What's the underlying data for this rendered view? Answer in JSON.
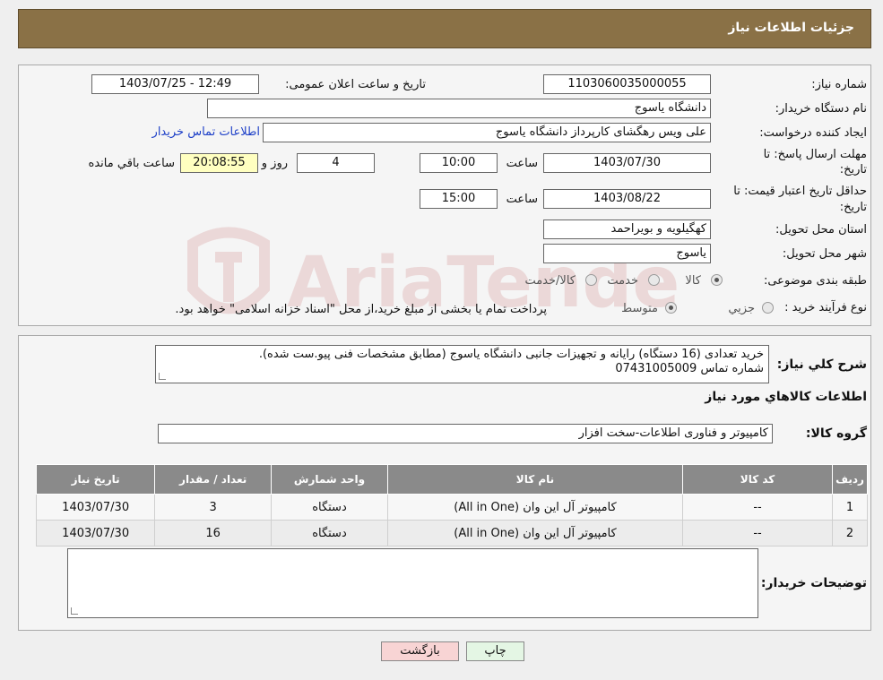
{
  "header": {
    "title": "جزئیات اطلاعات نیاز"
  },
  "form": {
    "need_number_label": "شماره نیاز:",
    "need_number": "1103060035000055",
    "announce_label": "تاریخ و ساعت اعلان عمومی:",
    "announce_value": "1403/07/25 - 12:49",
    "buyer_org_label": "نام دستگاه خریدار:",
    "buyer_org": "دانشگاه یاسوج",
    "requester_label": "ایجاد کننده درخواست:",
    "requester": "علی ویس رهگشای کارپرداز دانشگاه یاسوج",
    "contact_link": "اطلاعات تماس خریدار",
    "deadline_label_1": "مهلت ارسال پاسخ: تا",
    "deadline_label_2": "تاریخ:",
    "deadline_date": "1403/07/30",
    "time_label": "ساعت",
    "deadline_time": "10:00",
    "days_value": "4",
    "days_label": "روز و",
    "remaining_time": "20:08:55",
    "remaining_label": "ساعت باقي مانده",
    "validity_label_1": "حداقل تاریخ اعتبار قیمت: تا",
    "validity_label_2": "تاریخ:",
    "validity_date": "1403/08/22",
    "validity_time": "15:00",
    "province_label": "استان محل تحویل:",
    "province": "کهگیلویه و بویراحمد",
    "city_label": "شهر محل تحویل:",
    "city": "یاسوج",
    "category_label": "طبقه بندی موضوعی:",
    "category_options": [
      "کالا",
      "خدمت",
      "کالا/خدمت"
    ],
    "purchase_type_label": "نوع فرآیند خرید :",
    "purchase_options": [
      "جزیي",
      "متوسط"
    ],
    "purchase_note": "پرداخت تمام یا بخشی از مبلغ خرید،از محل \"اسناد خزانه اسلامی\" خواهد بود."
  },
  "details": {
    "description_label": "شرح کلي نياز:",
    "description_line1": "خرید تعدادی (16 دستگاه)  رایانه و تجهیزات جانبی دانشگاه یاسوج (مطابق مشخصات فنی پیو.ست شده).",
    "description_line2": "شماره تماس 07431005009",
    "goods_info_title": "اطلاعات کالاهاي مورد نياز",
    "goods_group_label": "گروه کالا:",
    "goods_group": "کامپیوتر و فناوری اطلاعات-سخت افزار",
    "table_headers": [
      "رديف",
      "کد کالا",
      "نام کالا",
      "واحد شمارش",
      "تعداد / مقدار",
      "تاریخ نیاز"
    ],
    "rows": [
      [
        "1",
        "--",
        "کامپیوتر آل این وان (All in One)",
        "دستگاه",
        "3",
        "1403/07/30"
      ],
      [
        "2",
        "--",
        "کامپیوتر آل این وان (All in One)",
        "دستگاه",
        "16",
        "1403/07/30"
      ]
    ],
    "buyer_notes_label": "توضیحات خریدار:",
    "buyer_notes": ""
  },
  "buttons": {
    "print": "چاپ",
    "back": "بازگشت"
  },
  "watermark": {
    "text": "AriaTender.neT",
    "color": "#b02020"
  },
  "colors": {
    "header_bg": "#8a7146",
    "link": "#1e40c8",
    "back_button_bg": "#f8d4d4",
    "print_button_bg": "#e4f6e4"
  }
}
